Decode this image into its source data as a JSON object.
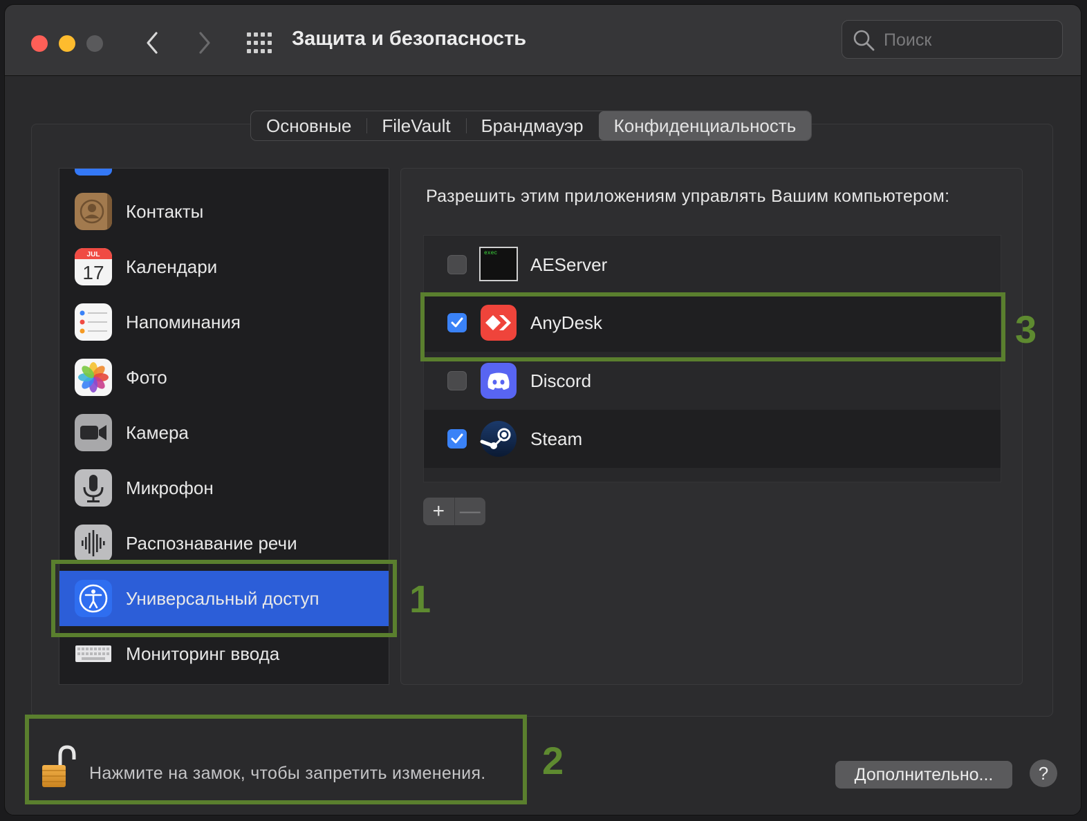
{
  "window": {
    "title": "Защита и безопасность"
  },
  "search": {
    "placeholder": "Поиск"
  },
  "tabs": [
    {
      "label": "Основные",
      "active": false
    },
    {
      "label": "FileVault",
      "active": false
    },
    {
      "label": "Брандмауэр",
      "active": false
    },
    {
      "label": "Конфиденциальность",
      "active": true
    }
  ],
  "sidebar": {
    "items": [
      {
        "label": "Контакты",
        "icon": "contacts-icon"
      },
      {
        "label": "Календари",
        "icon": "calendar-icon",
        "calendar_month": "JUL",
        "calendar_day": "17"
      },
      {
        "label": "Напоминания",
        "icon": "reminders-icon"
      },
      {
        "label": "Фото",
        "icon": "photos-icon"
      },
      {
        "label": "Камера",
        "icon": "camera-icon"
      },
      {
        "label": "Микрофон",
        "icon": "microphone-icon"
      },
      {
        "label": "Распознавание речи",
        "icon": "speech-recognition-icon"
      },
      {
        "label": "Универсальный доступ",
        "icon": "accessibility-icon",
        "selected": true
      },
      {
        "label": "Мониторинг ввода",
        "icon": "keyboard-icon"
      }
    ]
  },
  "pane": {
    "heading": "Разрешить этим приложениям управлять Вашим компьютером:",
    "apps": [
      {
        "label": "AEServer",
        "checked": false,
        "icon": "terminal-exec-icon",
        "icon_text": "exec"
      },
      {
        "label": "AnyDesk",
        "checked": true,
        "icon": "anydesk-icon"
      },
      {
        "label": "Discord",
        "checked": false,
        "icon": "discord-icon"
      },
      {
        "label": "Steam",
        "checked": true,
        "icon": "steam-icon"
      }
    ],
    "add_label": "+",
    "remove_label": "—"
  },
  "footer": {
    "lock_text": "Нажмите на замок, чтобы запретить изменения.",
    "advanced_label": "Дополнительно...",
    "help_label": "?"
  },
  "annotations": {
    "n1": "1",
    "n2": "2",
    "n3": "3",
    "color": "#5a7f2e"
  }
}
